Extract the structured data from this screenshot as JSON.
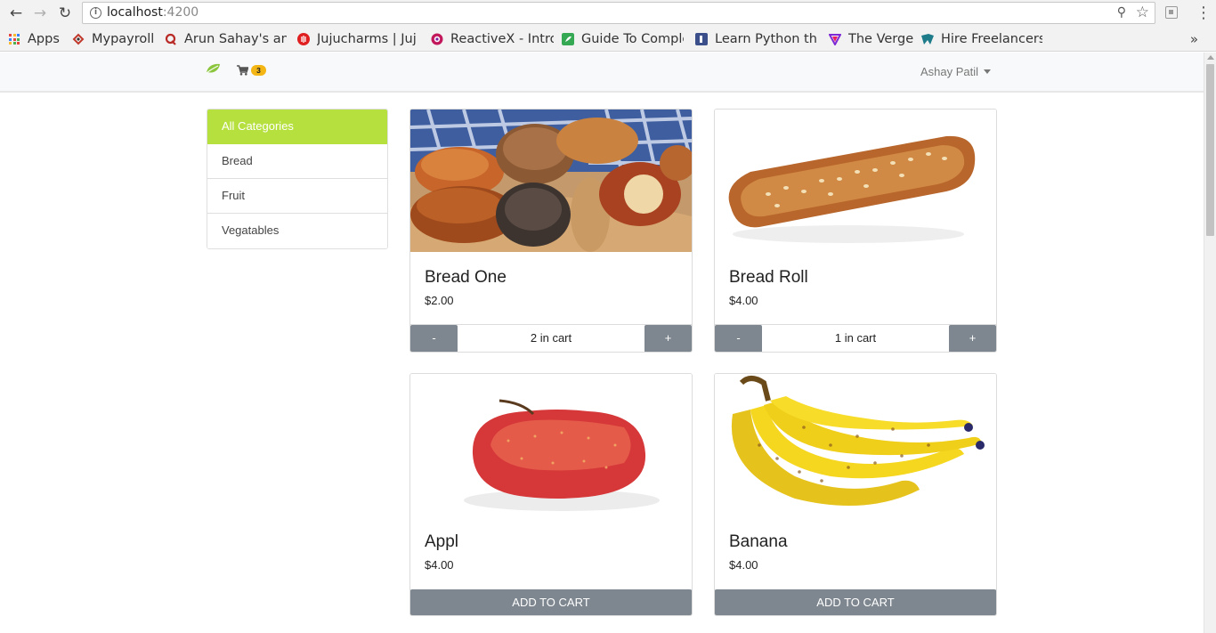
{
  "browser": {
    "url_host": "localhost",
    "url_port": ":4200",
    "bookmarks_more": "»",
    "bookmarks": [
      {
        "label": "Apps",
        "icon": "apps-grid-icon"
      },
      {
        "label": "Mypayroll",
        "icon": "mypayroll-icon",
        "color": "#c0392b"
      },
      {
        "label": "Arun Sahay's ans",
        "icon": "quora-icon",
        "color": "#b92b27"
      },
      {
        "label": "Jujucharms | Juj",
        "icon": "juju-icon",
        "color": "#e02020"
      },
      {
        "label": "ReactiveX - Intro",
        "icon": "reactivex-icon",
        "color": "#c2185b"
      },
      {
        "label": "Guide To Comple",
        "icon": "guide-icon",
        "color": "#34a853"
      },
      {
        "label": "Learn Python the",
        "icon": "python-book-icon",
        "color": "#3b4f8a"
      },
      {
        "label": "The Verge",
        "icon": "verge-icon",
        "color": "#7d2ad6"
      },
      {
        "label": "Hire Freelancers",
        "icon": "freelancer-icon",
        "color": "#1d7b8a"
      }
    ]
  },
  "navbar": {
    "cart_count": "3",
    "user_name": "Ashay Patil"
  },
  "categories": [
    {
      "label": "All Categories",
      "active": true
    },
    {
      "label": "Bread",
      "active": false
    },
    {
      "label": "Fruit",
      "active": false
    },
    {
      "label": "Vegatables",
      "active": false
    }
  ],
  "products": [
    {
      "title": "Bread One",
      "price": "$2.00",
      "in_cart": "2 in cart",
      "minus": "-",
      "plus": "+",
      "image": "bread-basket-image"
    },
    {
      "title": "Bread Roll",
      "price": "$4.00",
      "in_cart": "1 in cart",
      "minus": "-",
      "plus": "+",
      "image": "baguette-image"
    },
    {
      "title": "Appl",
      "price": "$4.00",
      "add_label": "ADD TO CART",
      "image": "apple-image"
    },
    {
      "title": "Banana",
      "price": "$4.00",
      "add_label": "ADD TO CART",
      "image": "banana-image"
    }
  ],
  "colors": {
    "accent": "#b5e03d",
    "button": "#7e878f",
    "badge": "#f3b614"
  }
}
